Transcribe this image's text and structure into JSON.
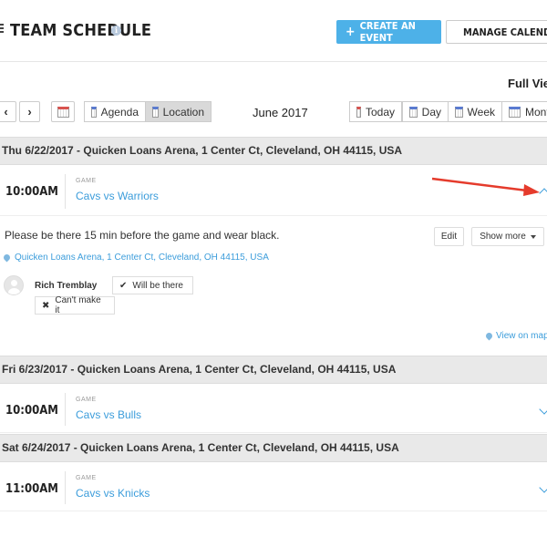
{
  "header": {
    "title": "TEAM SCHEDULE",
    "create_label": "CREATE AN EVENT",
    "manage_label": "MANAGE CALENDAR"
  },
  "toolbar": {
    "full_view": "Full View",
    "agenda_label": "Agenda",
    "location_label": "Location",
    "month": "June 2017",
    "today_label": "Today",
    "day_label": "Day",
    "week_label": "Week",
    "month_label": "Month",
    "prev_icon": "‹",
    "next_icon": "›"
  },
  "days": [
    {
      "header": "Thu 6/22/2017 - Quicken Loans Arena, 1 Center Ct, Cleveland, OH 44115, USA",
      "event": {
        "time": "10:00AM",
        "type": "GAME",
        "title": "Cavs vs Warriors"
      }
    },
    {
      "header": "Fri 6/23/2017 - Quicken Loans Arena, 1 Center Ct, Cleveland, OH 44115, USA",
      "event": {
        "time": "10:00AM",
        "type": "GAME",
        "title": "Cavs vs Bulls"
      }
    },
    {
      "header": "Sat 6/24/2017 - Quicken Loans Arena, 1 Center Ct, Cleveland, OH 44115, USA",
      "event": {
        "time": "11:00AM",
        "type": "GAME",
        "title": "Cavs vs Knicks"
      }
    }
  ],
  "details": {
    "description": "Please be there 15 min before the game and wear black.",
    "edit_label": "Edit",
    "show_more_label": "Show more",
    "location": "Quicken Loans Arena, 1 Center Ct, Cleveland, OH 44115, USA",
    "member_name": "Rich Tremblay",
    "will_be_there": "Will be there",
    "cant_make_it": "Can't make it",
    "view_on_map": "View on map"
  },
  "colors": {
    "accent": "#4db1e8",
    "link": "#3c9ddb",
    "annotation_arrow": "#e53b2c"
  }
}
